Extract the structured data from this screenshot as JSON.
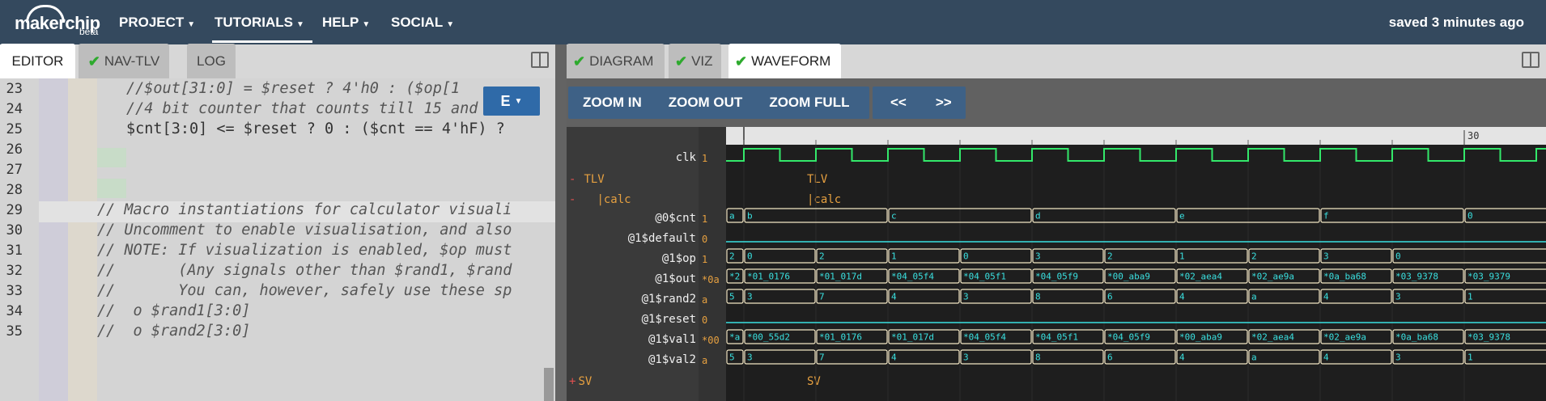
{
  "header": {
    "logo_text": "makerchip",
    "logo_badge": "beta",
    "nav": [
      {
        "label": "PROJECT"
      },
      {
        "label": "TUTORIALS"
      },
      {
        "label": "HELP"
      },
      {
        "label": "SOCIAL"
      }
    ],
    "status": "saved 3 minutes ago"
  },
  "left_tabs": [
    {
      "label": "EDITOR",
      "checked": false
    },
    {
      "label": "NAV-TLV",
      "checked": true
    },
    {
      "label": "LOG",
      "checked": false
    }
  ],
  "right_tabs": [
    {
      "label": "DIAGRAM",
      "checked": true
    },
    {
      "label": "VIZ",
      "checked": true
    },
    {
      "label": "WAVEFORM",
      "checked": true
    }
  ],
  "editor": {
    "dropdown_label": "E",
    "line_numbers": [
      "23",
      "24",
      "25",
      "26",
      "27",
      "28",
      "29",
      "30",
      "31",
      "32",
      "33",
      "34",
      "35"
    ],
    "lines": [
      "//$out[31:0] = $reset ? 4'h0 : ($op[1",
      "//4 bit counter that counts till 15 and be",
      "$cnt[3:0] <= $reset ? 0 : ($cnt == 4'hF) ?",
      "",
      "",
      "",
      "// Macro instantiations for calculator visuali",
      "// Uncomment to enable visualisation, and also",
      "// NOTE: If visualization is enabled, $op must",
      "//       (Any signals other than $rand1, $rand",
      "//       You can, however, safely use these sp",
      "//  o $rand1[3:0]",
      "//  o $rand2[3:0]"
    ]
  },
  "waveform": {
    "buttons": {
      "zoom_in": "ZOOM IN",
      "zoom_out": "ZOOM OUT",
      "zoom_full": "ZOOM FULL",
      "prev": "<<",
      "next": ">>"
    },
    "time_marker": "30",
    "rows": [
      {
        "name": "clk",
        "value": "1",
        "kind": "clock"
      },
      {
        "name": "TLV",
        "kind": "scope",
        "toggle": "-",
        "label": "TLV"
      },
      {
        "name": "|calc",
        "kind": "scope",
        "toggle": "-",
        "label": "|calc"
      },
      {
        "name": "@0$cnt",
        "value": "1",
        "kind": "bus",
        "segments": [
          "a",
          "b",
          "c",
          "d",
          "e",
          "f",
          "0"
        ]
      },
      {
        "name": "@1$default",
        "value": "0",
        "kind": "flat"
      },
      {
        "name": "@1$op",
        "value": "1",
        "kind": "bus",
        "segments": [
          "2",
          "0",
          "2",
          "1",
          "0",
          "3",
          "2",
          "1",
          "2",
          "3",
          "0"
        ]
      },
      {
        "name": "@1$out",
        "value": "*0a",
        "kind": "bus",
        "segments": [
          "*2",
          "*01_0176",
          "*01_017d",
          "*04_05f4",
          "*04_05f1",
          "*04_05f9",
          "*00_aba9",
          "*02_aea4",
          "*02_ae9a",
          "*0a_ba68",
          "*03_9378",
          "*03_9379"
        ]
      },
      {
        "name": "@1$rand2",
        "value": "a",
        "kind": "bus",
        "segments": [
          "5",
          "3",
          "7",
          "4",
          "3",
          "8",
          "6",
          "4",
          "a",
          "4",
          "3",
          "1"
        ]
      },
      {
        "name": "@1$reset",
        "value": "0",
        "kind": "flat"
      },
      {
        "name": "@1$val1",
        "value": "*00",
        "kind": "bus",
        "segments": [
          "*a",
          "*00_55d2",
          "*01_0176",
          "*01_017d",
          "*04_05f4",
          "*04_05f1",
          "*04_05f9",
          "*00_aba9",
          "*02_aea4",
          "*02_ae9a",
          "*0a_ba68",
          "*03_9378"
        ]
      },
      {
        "name": "@1$val2",
        "value": "a",
        "kind": "bus",
        "segments": [
          "5",
          "3",
          "7",
          "4",
          "3",
          "8",
          "6",
          "4",
          "a",
          "4",
          "3",
          "1"
        ]
      },
      {
        "name": "SV",
        "kind": "scope",
        "toggle": "+",
        "label": "SV"
      }
    ]
  },
  "colors": {
    "topbar": "#34495e",
    "accent_blue": "#2f6aa8",
    "wave_green": "#33e86a",
    "wave_cyan": "#3ae0e0",
    "bus_outline": "#f3e7c4",
    "scope_orange": "#e6a040",
    "check_green": "#2eaa2e"
  }
}
